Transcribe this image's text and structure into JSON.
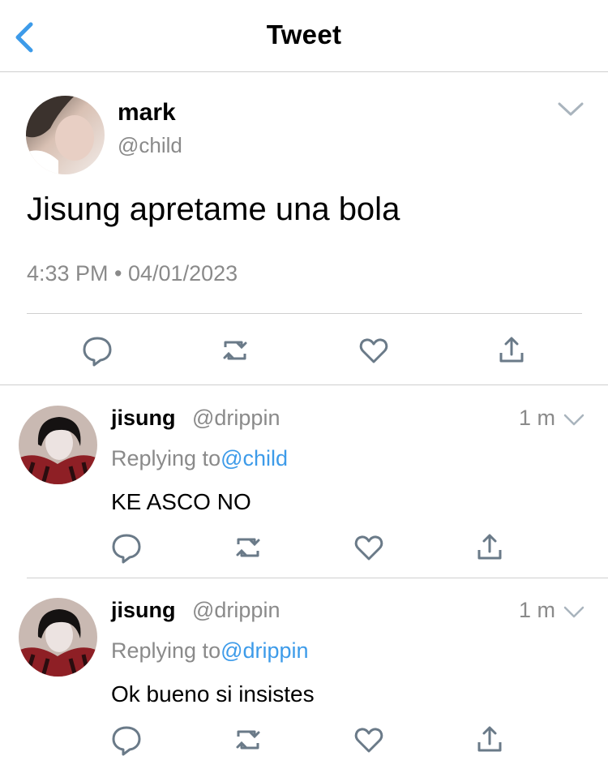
{
  "header": {
    "title": "Tweet",
    "back_icon": "chevron-left-icon"
  },
  "tweet": {
    "author_name": "mark",
    "author_handle": "@child",
    "text": "Jisung apretame una bola",
    "meta": "4:33 PM • 04/01/2023",
    "actions": [
      "reply-icon",
      "retweet-icon",
      "like-icon",
      "share-icon"
    ]
  },
  "replies": [
    {
      "author_name": "jisung",
      "author_handle": "@drippin",
      "time": "1 m",
      "replying_prefix": "Replying to",
      "replying_to": "@child",
      "text": "KE ASCO NO"
    },
    {
      "author_name": "jisung",
      "author_handle": "@drippin",
      "time": "1 m",
      "replying_prefix": "Replying to",
      "replying_to": "@drippin",
      "text": "Ok bueno si insistes"
    }
  ],
  "colors": {
    "accent": "#3d9be9",
    "secondary_text": "#8a8a8a",
    "icon": "#6a7a88",
    "divider": "#cfcfcf"
  }
}
